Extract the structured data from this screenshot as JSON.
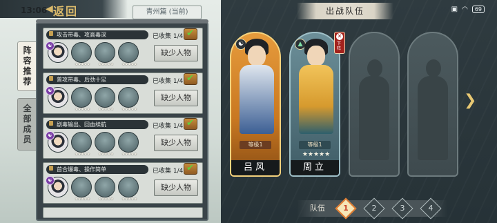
{
  "status_bar": {
    "time": "13:06",
    "battery": "69"
  },
  "header": {
    "back_arrow": "◀",
    "back_label": "返回",
    "region": "青州篇 (当前)"
  },
  "tabs": [
    {
      "label": "阵容推荐",
      "chars": [
        "阵",
        "容",
        "推",
        "荐"
      ]
    },
    {
      "label": "全部成员",
      "chars": [
        "全",
        "部",
        "成",
        "员"
      ]
    }
  ],
  "recommendations": [
    {
      "title": "攻击带毒、攻高毒深",
      "collected": "已收集 1/4",
      "button": "缺少人物",
      "element_badge": "☯"
    },
    {
      "title": "普攻带毒、后劲十足",
      "collected": "已收集 1/4",
      "button": "缺少人物",
      "element_badge": "☯"
    },
    {
      "title": "剧毒输出、回血续航",
      "collected": "已收集 1/4",
      "button": "缺少人物",
      "element_badge": "☯"
    },
    {
      "title": "首合爆毒、操作简单",
      "collected": "已收集 1/4",
      "button": "缺少人物",
      "element_badge": "☯"
    }
  ],
  "lineup": {
    "banner": "出战队伍",
    "slots": [
      {
        "name": "吕风",
        "level": "等级1",
        "stars": "",
        "element": "☯",
        "state": "filled",
        "frame_color": "#e69b3c"
      },
      {
        "name": "周立",
        "level": "等级1",
        "stars": "★★★★★",
        "element": "▲",
        "state": "filled",
        "frame_color": "#6c8f99",
        "remove_label": "下阵",
        "remove_icon": "✕"
      },
      {
        "state": "empty"
      },
      {
        "state": "empty"
      }
    ],
    "next_arrow": "❯"
  },
  "team": {
    "label": "队伍",
    "numbers": [
      "1",
      "2",
      "3",
      "4"
    ],
    "active_index": 0
  }
}
